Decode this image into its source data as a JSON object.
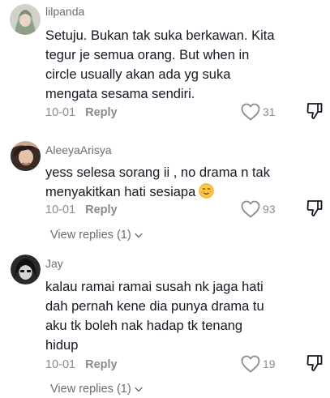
{
  "comments": [
    {
      "username": "lilpanda",
      "text": "Setuju. Bukan tak suka berkawan. Kita tegur je semua orang. But when in circle usually akan ada yg suka mengata sesama sendiri.",
      "date": "10-01",
      "reply_label": "Reply",
      "likes": "31"
    },
    {
      "username": "AleeyaArisya",
      "text": "yess selesa sorang ii , no drama n tak menyakitkan hati sesiapa",
      "emoji": "smiling-face-emoji",
      "date": "10-01",
      "reply_label": "Reply",
      "likes": "93",
      "view_replies": "View replies (1)"
    },
    {
      "username": "Jay",
      "text": "kalau ramai ramai susah nk jaga hati dah pernah kene dia punya drama tu aku tk boleh nak hadap tk tenang hidup",
      "date": "10-01",
      "reply_label": "Reply",
      "likes": "19",
      "view_replies": "View replies (1)"
    }
  ],
  "colors": {
    "text": "#161823",
    "secondary": "#8a8b91",
    "username": "#6b6d74"
  }
}
